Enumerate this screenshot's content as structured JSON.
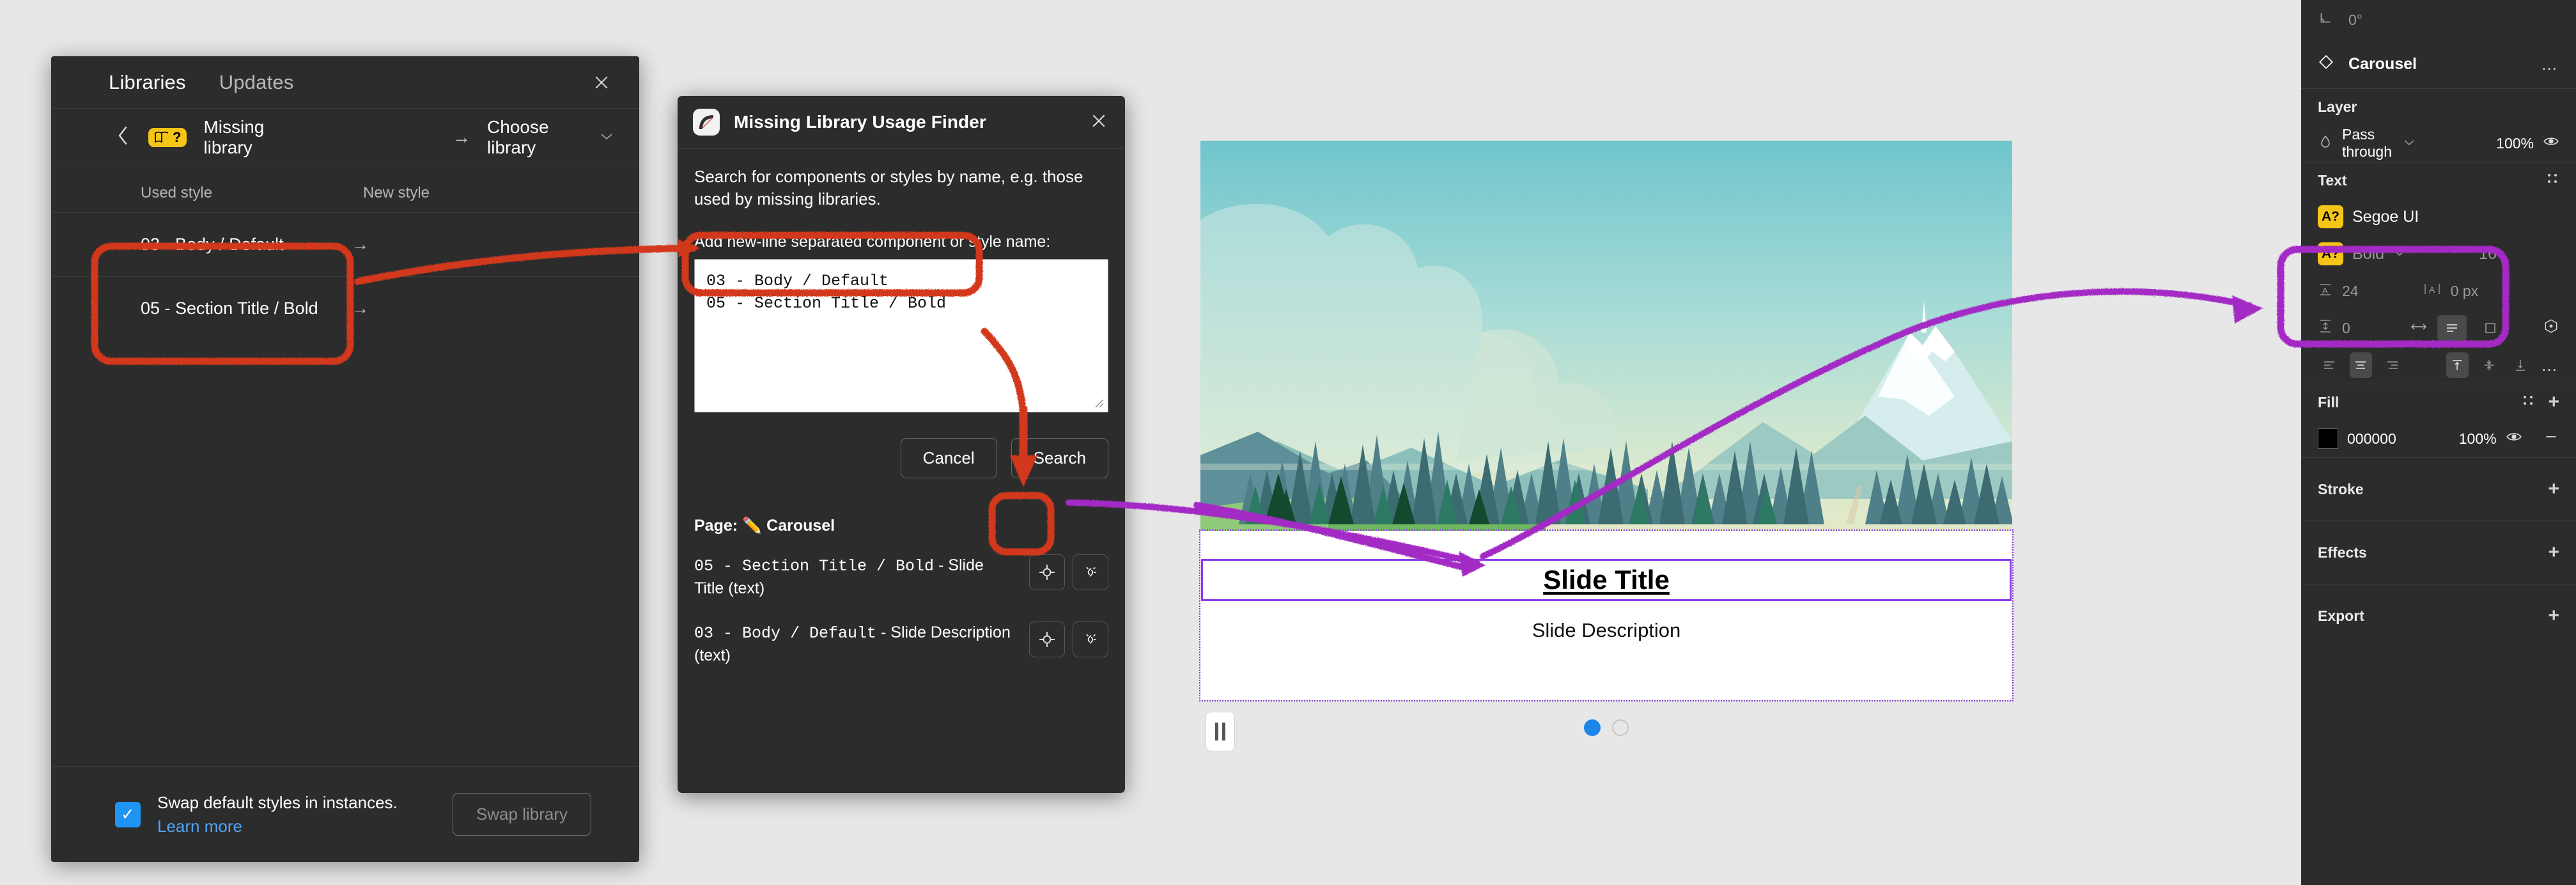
{
  "libraries_panel": {
    "tabs": [
      {
        "label": "Libraries",
        "active": true
      },
      {
        "label": "Updates",
        "active": false
      }
    ],
    "close_icon": "close-icon",
    "breadcrumb": {
      "back_icon": "chevron-left-icon",
      "badge_icon": "book-question-icon",
      "badge_text": "?",
      "missing_library": "Missing library",
      "arrow": "→",
      "choose_library": "Choose library",
      "chevron": "⌄"
    },
    "columns": {
      "used": "Used style",
      "new": "New style"
    },
    "rows": [
      {
        "used": "03 - Body / Default",
        "arrow": "→",
        "new": ""
      },
      {
        "used": "05 - Section Title / Bold",
        "arrow": "→",
        "new": ""
      }
    ],
    "footer": {
      "checkbox_checked": true,
      "check_glyph": "✓",
      "swap_label": "Swap default styles in instances.",
      "learn_more": "Learn more",
      "swap_button": "Swap library"
    }
  },
  "plugin_dialog": {
    "icon_name": "missing-library-plugin-icon",
    "title": "Missing Library Usage Finder",
    "close_icon": "close-icon",
    "description": "Search for components or styles by name, e.g. those used by missing libraries.",
    "field_label": "Add new-line separated component or style name:",
    "textarea_value": "03 - Body / Default\n05 - Section Title / Bold",
    "textarea_placeholder": "",
    "buttons": {
      "cancel": "Cancel",
      "search": "Search"
    },
    "page_label": "Page:",
    "page_emoji": "✏️",
    "page_name": "Carousel",
    "results": [
      {
        "style": "05 - Section Title / Bold",
        "separator": " - ",
        "node": "Slide Title (text)",
        "select_icon": "crosshair-target-icon",
        "detach_icon": "broken-link-icon"
      },
      {
        "style": "03 - Body / Default",
        "separator": " - ",
        "node": "Slide Description (text)",
        "select_icon": "crosshair-target-icon",
        "detach_icon": "broken-link-icon"
      }
    ]
  },
  "carousel": {
    "slide_title": "Slide Title",
    "slide_description": "Slide Description",
    "pause_icon": "pause-icon",
    "dots": [
      {
        "state": "active"
      },
      {
        "state": "inactive"
      }
    ],
    "active_dot_color": "#1c85e8",
    "selection_color": "#8b3ee8"
  },
  "inspector": {
    "rotation": {
      "icon": "rotation-angle-icon",
      "value": "0°"
    },
    "layer_name": {
      "icon": "component-diamond-icon",
      "text": "Carousel",
      "more_icon": "more-horizontal-icon"
    },
    "layer": {
      "title": "Layer",
      "blend_icon": "blend-mode-icon",
      "blend_mode": "Pass through",
      "chevron": "⌄",
      "opacity": "100%",
      "visibility_icon": "eye-icon"
    },
    "text": {
      "title": "Text",
      "options_icon": "text-styles-icon",
      "font_badge": "A?",
      "font_family": "Segoe UI",
      "font_weight_badge": "A?",
      "font_weight": "Bold",
      "chevron": "⌄",
      "font_size": "16",
      "line_height_icon": "line-height-icon",
      "line_height": "24",
      "letter_spacing_icon": "letter-spacing-icon",
      "letter_spacing": "0 px",
      "paragraph_spacing_icon": "paragraph-spacing-icon",
      "paragraph_spacing": "0",
      "resize_icon": "horizontal-resize-icon",
      "autoheight_icon": "auto-height-icon",
      "fixed_icon": "fixed-size-icon",
      "advanced_icon": "advanced-type-icon",
      "align_left_icon": "align-left-icon",
      "align_center_icon": "align-center-icon",
      "align_right_icon": "align-right-icon",
      "valign_top_icon": "valign-top-icon",
      "valign_middle_icon": "valign-middle-icon",
      "valign_bottom_icon": "valign-bottom-icon",
      "more_icon": "more-horizontal-icon"
    },
    "fill": {
      "title": "Fill",
      "styles_icon": "fill-styles-icon",
      "add_icon": "plus-icon",
      "color_hex": "000000",
      "color_value": "#000000",
      "opacity": "100%",
      "visibility_icon": "eye-icon",
      "remove_icon": "minus-icon"
    },
    "stroke": {
      "title": "Stroke",
      "add_icon": "plus-icon"
    },
    "effects": {
      "title": "Effects",
      "add_icon": "plus-icon"
    },
    "export": {
      "title": "Export",
      "add_icon": "plus-icon"
    }
  },
  "annotations": {
    "red_color": "#d2391c",
    "purple_color": "#a32cc4",
    "red_marks": [
      "box-around-used-styles",
      "box-around-textarea-lines",
      "arrow-from-used-styles-to-textarea",
      "arrow-from-search-button-to-select-icon",
      "box-around-select-icon"
    ],
    "purple_marks": [
      "arrow-from-select-icon-to-slide-title",
      "arrow-from-slide-title-to-text-panel",
      "box-around-font-fields"
    ]
  }
}
